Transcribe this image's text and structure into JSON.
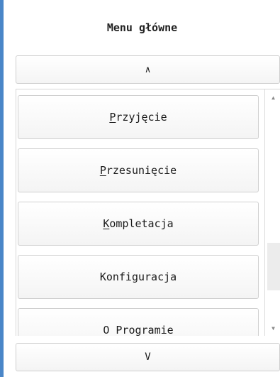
{
  "title": "Menu główne",
  "nav": {
    "up_label": "∧",
    "down_label": "V"
  },
  "menu": {
    "items": [
      {
        "before": "",
        "key": "P",
        "after": "rzyjęcie"
      },
      {
        "before": "",
        "key": "P",
        "after": "rzesunięcie"
      },
      {
        "before": "",
        "key": "K",
        "after": "ompletacja"
      },
      {
        "before": "",
        "key": "",
        "after": "Konfiguracja"
      },
      {
        "before": "",
        "key": "",
        "after": "O Programie"
      }
    ]
  },
  "scroll": {
    "position": 0.82,
    "visible_fraction": 0.22
  }
}
